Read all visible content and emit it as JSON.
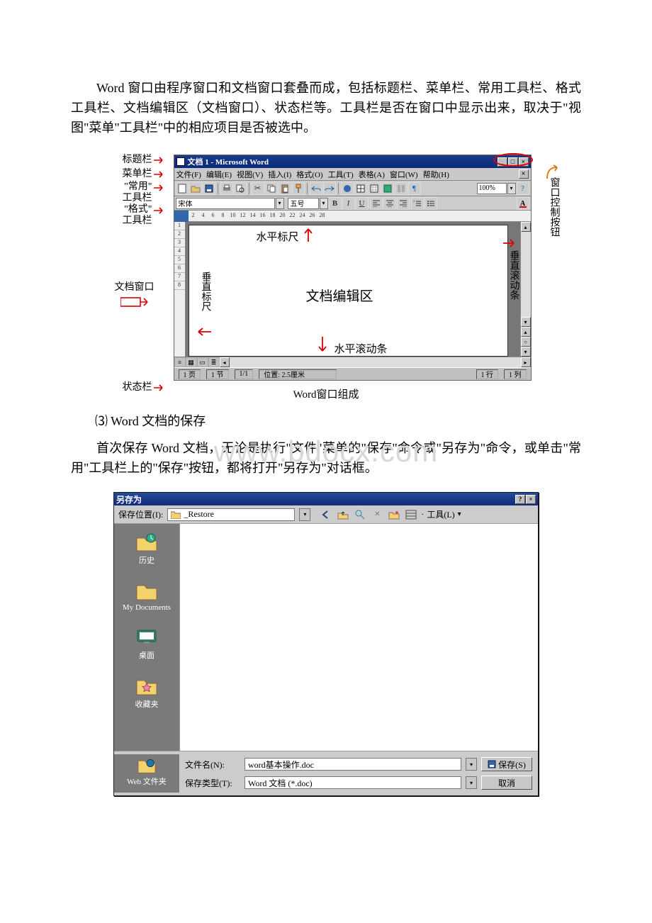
{
  "paragraphs": {
    "intro": "Word 窗口由程序窗口和文档窗口套叠而成，包括标题栏、菜单栏、常用工具栏、格式工具栏、文档编辑区（文档窗口）、状态栏等。工具栏是否在窗口中显示出来，取决于\"视图\"菜单\"工具栏\"中的相应项目是否被选中。",
    "save_heading": "⑶ Word 文档的保存",
    "save_body": "首次保存 Word 文档，无论是执行\"文件\"菜单的\"保存\"命令或\"另存为\"命令，或单击\"常用\"工具栏上的\"保存\"按钮，都将打开\"另存为\"对话框。"
  },
  "watermark": "www.bdocx.com",
  "labels": {
    "left": [
      "标题栏",
      "菜单栏",
      "\"常用\"\n工具栏",
      "\"格式\"\n工具栏",
      "文档窗口",
      "状态栏"
    ],
    "right_window_control": "窗口控制按钮",
    "vscroll": "垂直滚动条",
    "hruler": "水平标尺",
    "vruler": "垂直标尺",
    "hscroll": "水平滚动条",
    "editarea": "文档编辑区",
    "figure_caption": "Word窗口组成"
  },
  "word_window": {
    "title": "文档 1 - Microsoft Word",
    "menus": [
      "文件(F)",
      "编辑(E)",
      "视图(V)",
      "插入(I)",
      "格式(O)",
      "工具(T)",
      "表格(A)",
      "窗口(W)",
      "帮助(H)"
    ],
    "zoom": "100%",
    "font_name": "宋体",
    "font_size": "五号",
    "ruler_marks": [
      "2",
      "4",
      "6",
      "8",
      "10",
      "12",
      "14",
      "16",
      "18",
      "20",
      "22",
      "24",
      "26",
      "28"
    ],
    "vruler_marks": [
      "1",
      "2",
      "3",
      "4",
      "5",
      "6",
      "7",
      "8"
    ],
    "status": {
      "page": "1 页",
      "section": "1 节",
      "pages": "1/1",
      "position": "位置:  2.5厘米",
      "line": "1 行",
      "col": "1 列"
    }
  },
  "saveas": {
    "title": "另存为",
    "location_label": "保存位置(I):",
    "location_value": "_Restore",
    "tools_label": "工具(L)",
    "sidebar": [
      "历史",
      "My Documents",
      "桌面",
      "收藏夹",
      "Web 文件夹"
    ],
    "filename_label": "文件名(N):",
    "filename_value": "word基本操作.doc",
    "filetype_label": "保存类型(T):",
    "filetype_value": "Word 文档 (*.doc)",
    "save_btn": "保存(S)",
    "cancel_btn": "取消"
  }
}
